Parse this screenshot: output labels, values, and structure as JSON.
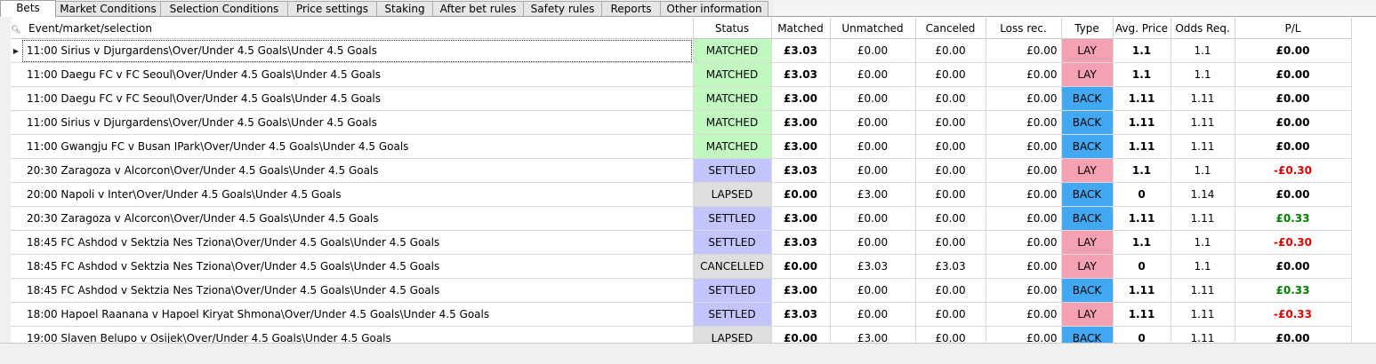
{
  "tabs": [
    {
      "label": "Bets",
      "active": true
    },
    {
      "label": "Market Conditions",
      "active": false
    },
    {
      "label": "Selection Conditions",
      "active": false
    },
    {
      "label": "Price settings",
      "active": false
    },
    {
      "label": "Staking",
      "active": false
    },
    {
      "label": "After bet rules",
      "active": false
    },
    {
      "label": "Safety rules",
      "active": false
    },
    {
      "label": "Reports",
      "active": false
    },
    {
      "label": "Other information",
      "active": false
    }
  ],
  "grid": {
    "search_icon": "magnifier-icon",
    "current_row_marker": "row-pointer-icon",
    "columns": [
      "Event/market/selection",
      "Status",
      "Matched",
      "Unmatched",
      "Canceled",
      "Loss rec.",
      "Type",
      "Avg. Price",
      "Odds Req.",
      "P/L"
    ],
    "rows": [
      {
        "event": "11:00 Sirius v Djurgardens\\Over/Under 4.5 Goals\\Under 4.5 Goals",
        "status": "MATCHED",
        "matched": "£3.03",
        "unmatched": "£0.00",
        "canceled": "£0.00",
        "loss_rec": "£0.00",
        "type": "LAY",
        "avg_price": "1.1",
        "odds_req": "1.1",
        "pl": "£0.00",
        "pl_sign": "zero",
        "current": true
      },
      {
        "event": "11:00 Daegu FC v FC Seoul\\Over/Under 4.5 Goals\\Under 4.5 Goals",
        "status": "MATCHED",
        "matched": "£3.03",
        "unmatched": "£0.00",
        "canceled": "£0.00",
        "loss_rec": "£0.00",
        "type": "LAY",
        "avg_price": "1.1",
        "odds_req": "1.1",
        "pl": "£0.00",
        "pl_sign": "zero"
      },
      {
        "event": "11:00 Daegu FC v FC Seoul\\Over/Under 4.5 Goals\\Under 4.5 Goals",
        "status": "MATCHED",
        "matched": "£3.00",
        "unmatched": "£0.00",
        "canceled": "£0.00",
        "loss_rec": "£0.00",
        "type": "BACK",
        "avg_price": "1.11",
        "odds_req": "1.11",
        "pl": "£0.00",
        "pl_sign": "zero"
      },
      {
        "event": "11:00 Sirius v Djurgardens\\Over/Under 4.5 Goals\\Under 4.5 Goals",
        "status": "MATCHED",
        "matched": "£3.00",
        "unmatched": "£0.00",
        "canceled": "£0.00",
        "loss_rec": "£0.00",
        "type": "BACK",
        "avg_price": "1.11",
        "odds_req": "1.11",
        "pl": "£0.00",
        "pl_sign": "zero"
      },
      {
        "event": "11:00 Gwangju FC v Busan IPark\\Over/Under 4.5 Goals\\Under 4.5 Goals",
        "status": "MATCHED",
        "matched": "£3.00",
        "unmatched": "£0.00",
        "canceled": "£0.00",
        "loss_rec": "£0.00",
        "type": "BACK",
        "avg_price": "1.11",
        "odds_req": "1.11",
        "pl": "£0.00",
        "pl_sign": "zero"
      },
      {
        "event": "20:30 Zaragoza v Alcorcon\\Over/Under 4.5 Goals\\Under 4.5 Goals",
        "status": "SETTLED",
        "matched": "£3.03",
        "unmatched": "£0.00",
        "canceled": "£0.00",
        "loss_rec": "£0.00",
        "type": "LAY",
        "avg_price": "1.1",
        "odds_req": "1.1",
        "pl": "-£0.30",
        "pl_sign": "neg"
      },
      {
        "event": "20:00 Napoli v Inter\\Over/Under 4.5 Goals\\Under 4.5 Goals",
        "status": "LAPSED",
        "matched": "£0.00",
        "unmatched": "£3.00",
        "canceled": "£0.00",
        "loss_rec": "£0.00",
        "type": "BACK",
        "avg_price": "0",
        "odds_req": "1.14",
        "pl": "£0.00",
        "pl_sign": "zero"
      },
      {
        "event": "20:30 Zaragoza v Alcorcon\\Over/Under 4.5 Goals\\Under 4.5 Goals",
        "status": "SETTLED",
        "matched": "£3.00",
        "unmatched": "£0.00",
        "canceled": "£0.00",
        "loss_rec": "£0.00",
        "type": "BACK",
        "avg_price": "1.11",
        "odds_req": "1.11",
        "pl": "£0.33",
        "pl_sign": "pos"
      },
      {
        "event": "18:45 FC Ashdod v Sektzia Nes Tziona\\Over/Under 4.5 Goals\\Under 4.5 Goals",
        "status": "SETTLED",
        "matched": "£3.03",
        "unmatched": "£0.00",
        "canceled": "£0.00",
        "loss_rec": "£0.00",
        "type": "LAY",
        "avg_price": "1.1",
        "odds_req": "1.1",
        "pl": "-£0.30",
        "pl_sign": "neg"
      },
      {
        "event": "18:45 FC Ashdod v Sektzia Nes Tziona\\Over/Under 4.5 Goals\\Under 4.5 Goals",
        "status": "CANCELLED",
        "matched": "£0.00",
        "unmatched": "£3.03",
        "canceled": "£3.03",
        "loss_rec": "£0.00",
        "type": "LAY",
        "avg_price": "0",
        "odds_req": "1.1",
        "pl": "£0.00",
        "pl_sign": "zero"
      },
      {
        "event": "18:45 FC Ashdod v Sektzia Nes Tziona\\Over/Under 4.5 Goals\\Under 4.5 Goals",
        "status": "SETTLED",
        "matched": "£3.00",
        "unmatched": "£0.00",
        "canceled": "£0.00",
        "loss_rec": "£0.00",
        "type": "BACK",
        "avg_price": "1.11",
        "odds_req": "1.11",
        "pl": "£0.33",
        "pl_sign": "pos"
      },
      {
        "event": "18:00 Hapoel Raanana v Hapoel Kiryat Shmona\\Over/Under 4.5 Goals\\Under 4.5 Goals",
        "status": "SETTLED",
        "matched": "£3.03",
        "unmatched": "£0.00",
        "canceled": "£0.00",
        "loss_rec": "£0.00",
        "type": "LAY",
        "avg_price": "1.11",
        "odds_req": "1.11",
        "pl": "-£0.33",
        "pl_sign": "neg"
      },
      {
        "event": "19:00 Slaven Belupo v Osijek\\Over/Under 4.5 Goals\\Under 4.5 Goals",
        "status": "LAPSED",
        "matched": "£0.00",
        "unmatched": "£3.00",
        "canceled": "£0.00",
        "loss_rec": "£0.00",
        "type": "BACK",
        "avg_price": "0",
        "odds_req": "1.11",
        "pl": "£0.00",
        "pl_sign": "zero"
      }
    ]
  }
}
